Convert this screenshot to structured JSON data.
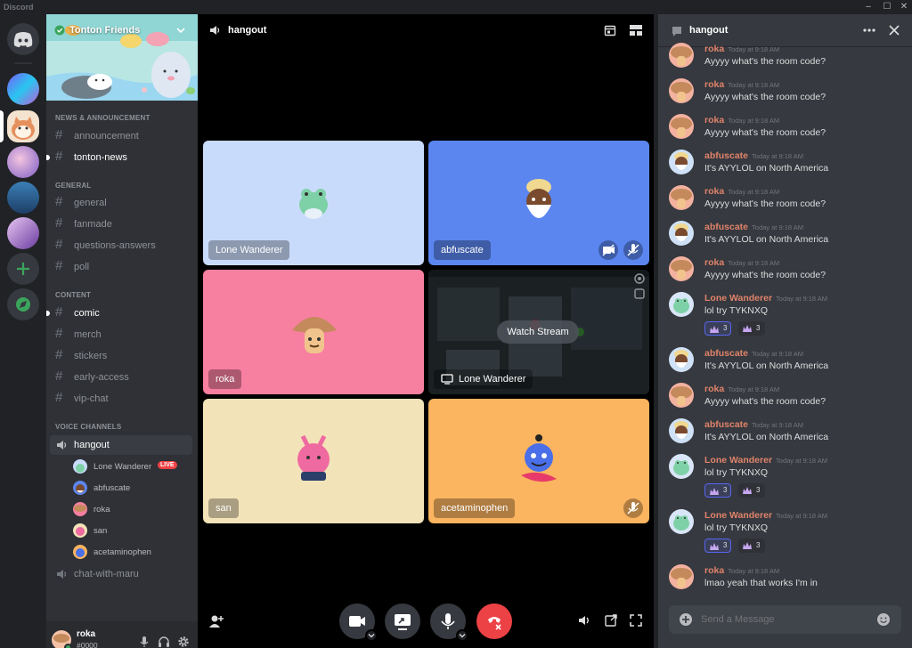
{
  "app": {
    "title": "Discord"
  },
  "window_controls": {
    "minimize": "–",
    "maximize": "☐",
    "close": "✕"
  },
  "server": {
    "name": "Tonton Friends"
  },
  "channels": {
    "categories": [
      {
        "name": "NEWS & ANNOUNCEMENT",
        "items": [
          {
            "name": "announcement"
          },
          {
            "name": "tonton-news"
          }
        ]
      },
      {
        "name": "GENERAL",
        "items": [
          {
            "name": "general"
          },
          {
            "name": "fanmade"
          },
          {
            "name": "questions-answers"
          },
          {
            "name": "poll"
          }
        ]
      },
      {
        "name": "CONTENT",
        "items": [
          {
            "name": "comic"
          },
          {
            "name": "merch"
          },
          {
            "name": "stickers"
          },
          {
            "name": "early-access"
          },
          {
            "name": "vip-chat"
          }
        ]
      }
    ],
    "voice_category": "VOICE CHANNELS",
    "voice_channels": [
      {
        "name": "hangout"
      },
      {
        "name": "chat-with-maru"
      }
    ],
    "voice_users": [
      {
        "name": "Lone Wanderer",
        "badge": "LIVE"
      },
      {
        "name": "abfuscate"
      },
      {
        "name": "roka"
      },
      {
        "name": "san"
      },
      {
        "name": "acetaminophen"
      }
    ]
  },
  "user_panel": {
    "username": "roka",
    "tag": "#0000"
  },
  "call": {
    "title": "hangout",
    "tiles": [
      {
        "name": "Lone Wanderer",
        "color": "#c9dbfb"
      },
      {
        "name": "abfuscate",
        "color": "#5b86f0"
      },
      {
        "name": "roka",
        "color": "#f77fa0"
      },
      {
        "name": "Lone Wanderer",
        "stream": true,
        "watch_label": "Watch Stream"
      },
      {
        "name": "san",
        "color": "#f3e3b9"
      },
      {
        "name": "acetaminophen",
        "color": "#fbb45f"
      }
    ]
  },
  "chat": {
    "title": "hangout",
    "placeholder": "Send a Message",
    "messages": [
      {
        "author": "roka",
        "time": "Today at 9:18 AM",
        "text": "Ayyyy what's the room code?"
      },
      {
        "author": "roka",
        "time": "Today at 9:18 AM",
        "text": "Ayyyy what's the room code?"
      },
      {
        "author": "roka",
        "time": "Today at 9:18 AM",
        "text": "Ayyyy what's the room code?"
      },
      {
        "author": "abfuscate",
        "time": "Today at 9:18 AM",
        "text": "It's AYYLOL on North America"
      },
      {
        "author": "roka",
        "time": "Today at 9:18 AM",
        "text": "Ayyyy what's the room code?"
      },
      {
        "author": "abfuscate",
        "time": "Today at 9:18 AM",
        "text": "It's AYYLOL on North America"
      },
      {
        "author": "roka",
        "time": "Today at 9:18 AM",
        "text": "Ayyyy what's the room code?"
      },
      {
        "author": "Lone Wanderer",
        "time": "Today at 9:18 AM",
        "text": "lol try TYKNXQ",
        "reactions": [
          {
            "count": "3"
          },
          {
            "count": "3"
          }
        ]
      },
      {
        "author": "abfuscate",
        "time": "Today at 9:18 AM",
        "text": "It's AYYLOL on North America"
      },
      {
        "author": "roka",
        "time": "Today at 9:18 AM",
        "text": "Ayyyy what's the room code?"
      },
      {
        "author": "abfuscate",
        "time": "Today at 9:18 AM",
        "text": "It's AYYLOL on North America"
      },
      {
        "author": "Lone Wanderer",
        "time": "Today at 9:18 AM",
        "text": "lol try TYKNXQ",
        "reactions": [
          {
            "count": "3"
          },
          {
            "count": "3"
          }
        ]
      },
      {
        "author": "Lone Wanderer",
        "time": "Today at 9:18 AM",
        "text": "lol try TYKNXQ",
        "reactions": [
          {
            "count": "3"
          },
          {
            "count": "3"
          }
        ]
      },
      {
        "author": "roka",
        "time": "Today at 9:18 AM",
        "text": "lmao yeah that works I'm in"
      }
    ]
  },
  "colors": {
    "accent": "#5865f2",
    "danger": "#ed4245",
    "online": "#3ba55c",
    "author": "#e0836a"
  }
}
